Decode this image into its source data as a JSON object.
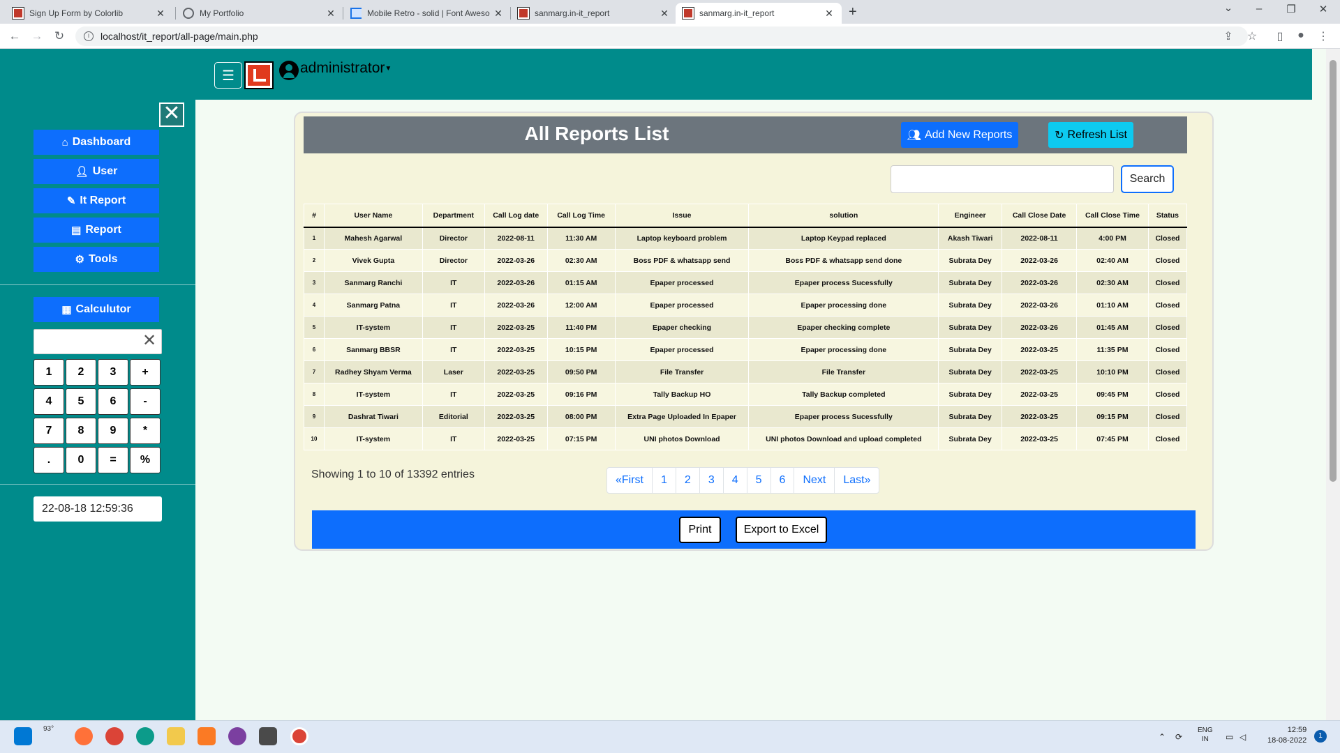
{
  "browser": {
    "tabs": [
      {
        "title": "Sign Up Form by Colorlib",
        "icon": "colorlib-favicon-icon",
        "active": false
      },
      {
        "title": "My Portfolio",
        "icon": "globe-icon",
        "active": false
      },
      {
        "title": "Mobile Retro - solid | Font Aweso",
        "icon": "flag-icon",
        "active": false
      },
      {
        "title": "sanmarg.in-it_report",
        "icon": "sanmarg-favicon-icon",
        "active": false
      },
      {
        "title": "sanmarg.in-it_report",
        "icon": "sanmarg-favicon-icon",
        "active": true
      }
    ],
    "new_tab": "+",
    "url": "localhost/it_report/all-page/main.php"
  },
  "header": {
    "user_name": "administrator"
  },
  "sidebar": {
    "nav": [
      {
        "label": "Dashboard",
        "icon": "home-icon"
      },
      {
        "label": "User",
        "icon": "user-icon"
      },
      {
        "label": "It Report",
        "icon": "pen-icon"
      },
      {
        "label": "Report",
        "icon": "file-icon"
      },
      {
        "label": "Tools",
        "icon": "gear-icon"
      }
    ],
    "calculator": {
      "label": "Calculutor",
      "display_value": "",
      "keys": [
        "1",
        "2",
        "3",
        "+",
        "4",
        "5",
        "6",
        "-",
        "7",
        "8",
        "9",
        "*",
        ".",
        "0",
        "=",
        "%"
      ]
    },
    "datetime": "22-08-18 12:59:36"
  },
  "main": {
    "title": "All Reports List",
    "add_button": "Add New Reports",
    "refresh_button": "Refresh List",
    "search_value": "",
    "search_button": "Search",
    "table": {
      "columns": [
        "#",
        "User Name",
        "Department",
        "Call Log date",
        "Call Log Time",
        "Issue",
        "solution",
        "Engineer",
        "Call Close Date",
        "Call Close Time",
        "Status"
      ],
      "rows": [
        [
          "1",
          "Mahesh Agarwal",
          "Director",
          "2022-08-11",
          "11:30 AM",
          "Laptop keyboard problem",
          "Laptop Keypad replaced",
          "Akash Tiwari",
          "2022-08-11",
          "4:00 PM",
          "Closed"
        ],
        [
          "2",
          "Vivek Gupta",
          "Director",
          "2022-03-26",
          "02:30 AM",
          "Boss PDF & whatsapp send",
          "Boss PDF & whatsapp send done",
          "Subrata Dey",
          "2022-03-26",
          "02:40 AM",
          "Closed"
        ],
        [
          "3",
          "Sanmarg Ranchi",
          "IT",
          "2022-03-26",
          "01:15 AM",
          "Epaper processed",
          "Epaper process Sucessfully",
          "Subrata Dey",
          "2022-03-26",
          "02:30 AM",
          "Closed"
        ],
        [
          "4",
          "Sanmarg Patna",
          "IT",
          "2022-03-26",
          "12:00 AM",
          "Epaper processed",
          "Epaper processing done",
          "Subrata Dey",
          "2022-03-26",
          "01:10 AM",
          "Closed"
        ],
        [
          "5",
          "IT-system",
          "IT",
          "2022-03-25",
          "11:40 PM",
          "Epaper checking",
          "Epaper checking complete",
          "Subrata Dey",
          "2022-03-26",
          "01:45 AM",
          "Closed"
        ],
        [
          "6",
          "Sanmarg BBSR",
          "IT",
          "2022-03-25",
          "10:15 PM",
          "Epaper processed",
          "Epaper processing done",
          "Subrata Dey",
          "2022-03-25",
          "11:35 PM",
          "Closed"
        ],
        [
          "7",
          "Radhey Shyam Verma",
          "Laser",
          "2022-03-25",
          "09:50 PM",
          "File Transfer",
          "File Transfer",
          "Subrata Dey",
          "2022-03-25",
          "10:10 PM",
          "Closed"
        ],
        [
          "8",
          "IT-system",
          "IT",
          "2022-03-25",
          "09:16 PM",
          "Tally Backup HO",
          "Tally Backup completed",
          "Subrata Dey",
          "2022-03-25",
          "09:45 PM",
          "Closed"
        ],
        [
          "9",
          "Dashrat Tiwari",
          "Editorial",
          "2022-03-25",
          "08:00 PM",
          "Extra Page Uploaded In Epaper",
          "Epaper process Sucessfully",
          "Subrata Dey",
          "2022-03-25",
          "09:15 PM",
          "Closed"
        ],
        [
          "10",
          "IT-system",
          "IT",
          "2022-03-25",
          "07:15 PM",
          "UNI photos Download",
          "UNI photos Download and upload completed",
          "Subrata Dey",
          "2022-03-25",
          "07:45 PM",
          "Closed"
        ]
      ]
    },
    "showing_text": "Showing 1 to 10 of 13392 entries",
    "pagination": [
      "«First",
      "1",
      "2",
      "3",
      "4",
      "5",
      "6",
      "Next",
      "Last»"
    ],
    "print_button": "Print",
    "export_button": "Export to Excel"
  },
  "taskbar": {
    "weather": "93°",
    "lang_line1": "ENG",
    "lang_line2": "IN",
    "time": "12:59",
    "date": "18-08-2022",
    "notifications": "1"
  },
  "colors": {
    "teal": "#008b8b",
    "primary": "#0d6efd",
    "info": "#0dcaf0",
    "card_bg": "#f5f4db",
    "header_gray": "#6c757d"
  }
}
